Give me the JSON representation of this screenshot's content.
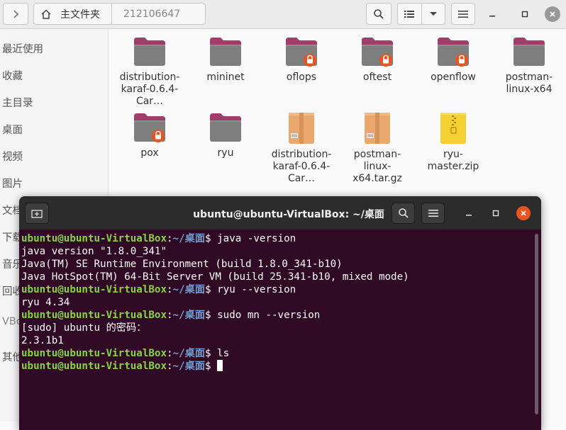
{
  "file_manager": {
    "path": {
      "home_label": "主文件夹",
      "current_label": "212106647"
    },
    "sidebar": {
      "items": [
        {
          "label": "最近使用"
        },
        {
          "label": "收藏"
        },
        {
          "label": "主目录"
        },
        {
          "label": "桌面"
        },
        {
          "label": "视频"
        },
        {
          "label": "图片"
        },
        {
          "label": "文档"
        },
        {
          "label": "下载"
        },
        {
          "label": "音乐"
        },
        {
          "label": "回收站"
        },
        {
          "label": "VBox"
        },
        {
          "label": "其他位置"
        }
      ]
    },
    "files": [
      {
        "name": "distribution-karaf-0.6.4-Car…",
        "type": "folder",
        "locked": false
      },
      {
        "name": "mininet",
        "type": "folder",
        "locked": false
      },
      {
        "name": "oflops",
        "type": "folder",
        "locked": true
      },
      {
        "name": "oftest",
        "type": "folder",
        "locked": true
      },
      {
        "name": "openflow",
        "type": "folder",
        "locked": true
      },
      {
        "name": "postman-linux-x64",
        "type": "folder",
        "locked": false
      },
      {
        "name": "pox",
        "type": "folder",
        "locked": true
      },
      {
        "name": "ryu",
        "type": "folder",
        "locked": false
      },
      {
        "name": "distribution-karaf-0.6.4-Car…",
        "type": "archive-tar",
        "locked": false
      },
      {
        "name": "postman-linux-x64.tar.gz",
        "type": "archive-tar",
        "locked": false
      },
      {
        "name": "ryu-master.zip",
        "type": "archive-zip",
        "locked": false
      }
    ]
  },
  "terminal": {
    "title": "ubuntu@ubuntu-VirtualBox: ~/桌面",
    "prompt": {
      "user_host": "ubuntu@ubuntu-VirtualBox",
      "sep": ":",
      "path": "~/桌面",
      "symbol": "$ "
    },
    "lines": [
      {
        "kind": "prompt",
        "cmd": "java -version"
      },
      {
        "kind": "output",
        "text": "java version \"1.8.0_341\""
      },
      {
        "kind": "output",
        "text": "Java(TM) SE Runtime Environment (build 1.8.0_341-b10)"
      },
      {
        "kind": "output",
        "text": "Java HotSpot(TM) 64-Bit Server VM (build 25.341-b10, mixed mode)"
      },
      {
        "kind": "prompt",
        "cmd": "ryu --version"
      },
      {
        "kind": "output",
        "text": "ryu 4.34"
      },
      {
        "kind": "prompt",
        "cmd": "sudo mn --version"
      },
      {
        "kind": "output",
        "text": "[sudo] ubuntu 的密码："
      },
      {
        "kind": "output",
        "text": "2.3.1b1"
      },
      {
        "kind": "prompt",
        "cmd": "ls"
      },
      {
        "kind": "prompt",
        "cmd": "",
        "cursor": true
      }
    ]
  },
  "colors": {
    "folder_body": "#7e7e7e",
    "folder_tab": "#a23d6b",
    "lock_badge": "#e95420",
    "archive_tar": "#e8a86e",
    "archive_zip": "#f5d033",
    "terminal_bg": "#300a24",
    "prompt_user": "#87d441",
    "prompt_path": "#729fcf"
  },
  "icons": {
    "forward": "chevron-right-icon",
    "home": "home-icon",
    "search": "search-icon",
    "view_list": "list-view-icon",
    "view_options": "chevron-down-icon",
    "menu": "hamburger-menu-icon",
    "minimize": "minimize-icon",
    "maximize": "maximize-icon",
    "close": "close-icon",
    "new_tab": "new-tab-icon",
    "lock": "lock-icon"
  }
}
